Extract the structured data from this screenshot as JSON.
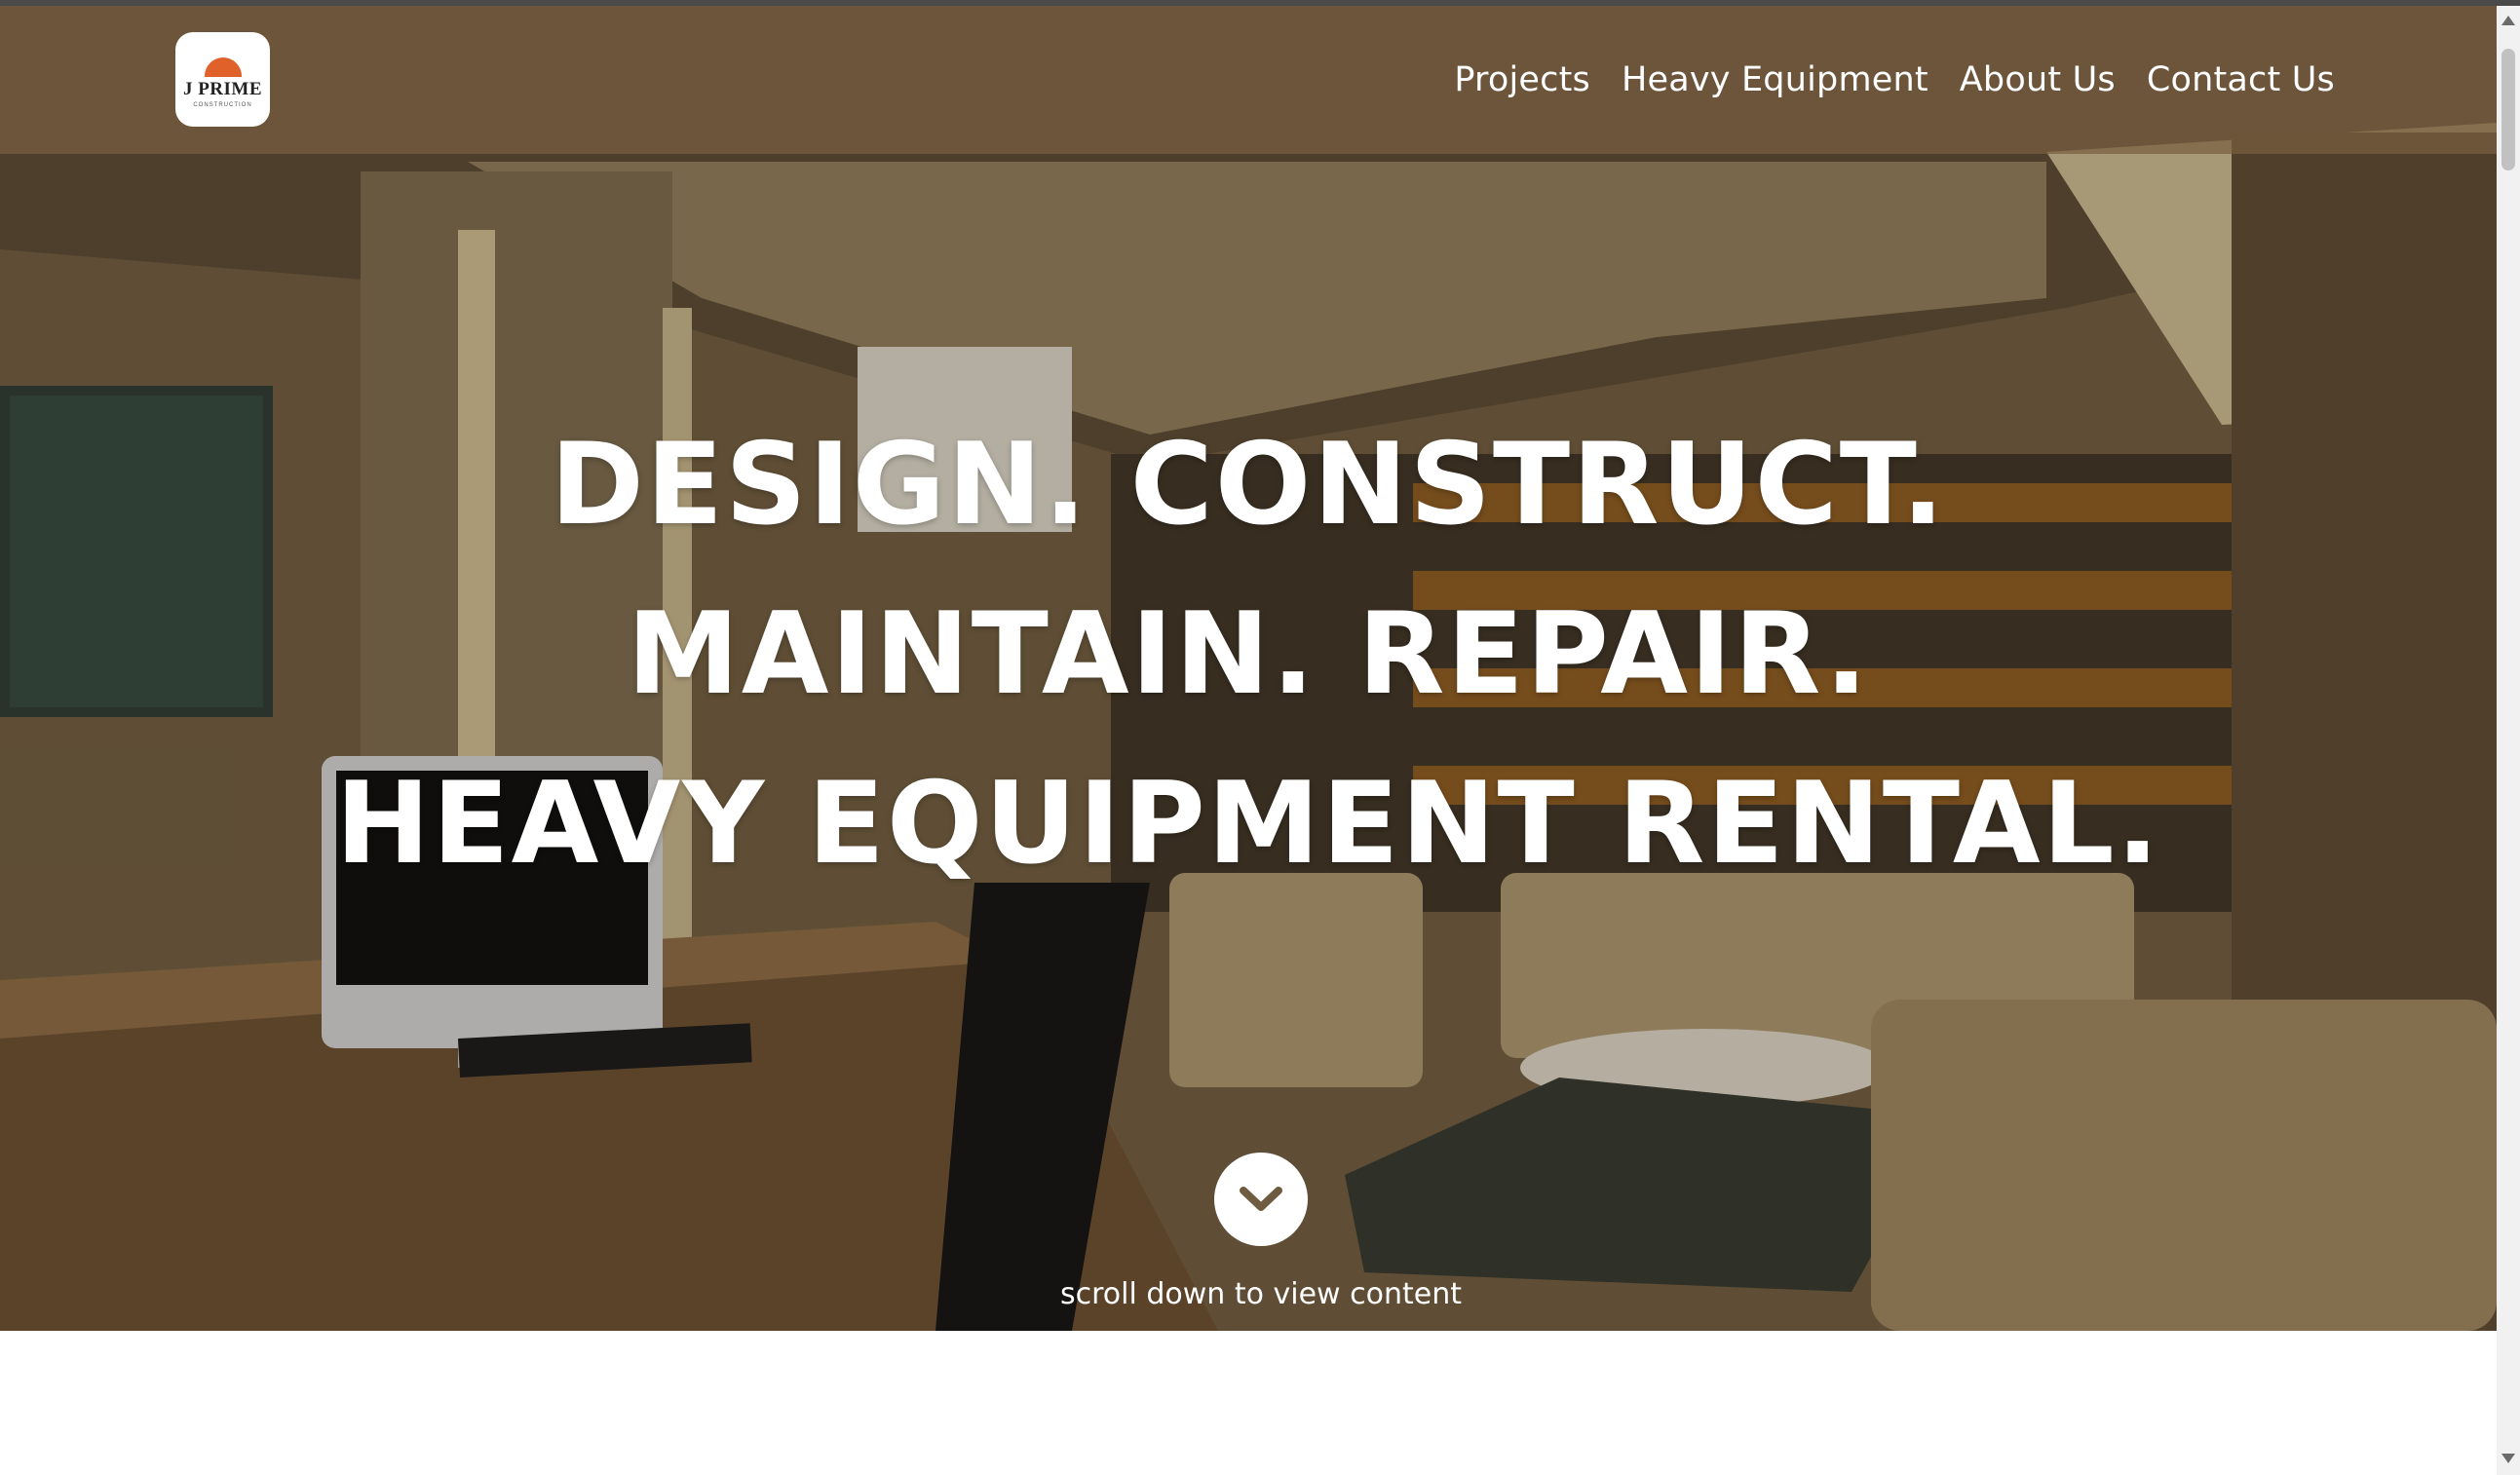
{
  "brand": {
    "logo_text": "J PRIME",
    "logo_sub": "CONSTRUCTION"
  },
  "nav": {
    "items": [
      "Projects",
      "Heavy Equipment",
      "About Us",
      "Contact Us"
    ]
  },
  "hero": {
    "lines": [
      "DESIGN. CONSTRUCT.",
      "MAINTAIN. REPAIR.",
      "HEAVY EQUIPMENT RENTAL."
    ],
    "scroll_hint": "scroll down to view content",
    "scroll_icon": "chevron-down-icon"
  },
  "colors": {
    "nav_bg": "#785e40",
    "headline": "#ffffff",
    "logo_accent": "#e0612a"
  }
}
